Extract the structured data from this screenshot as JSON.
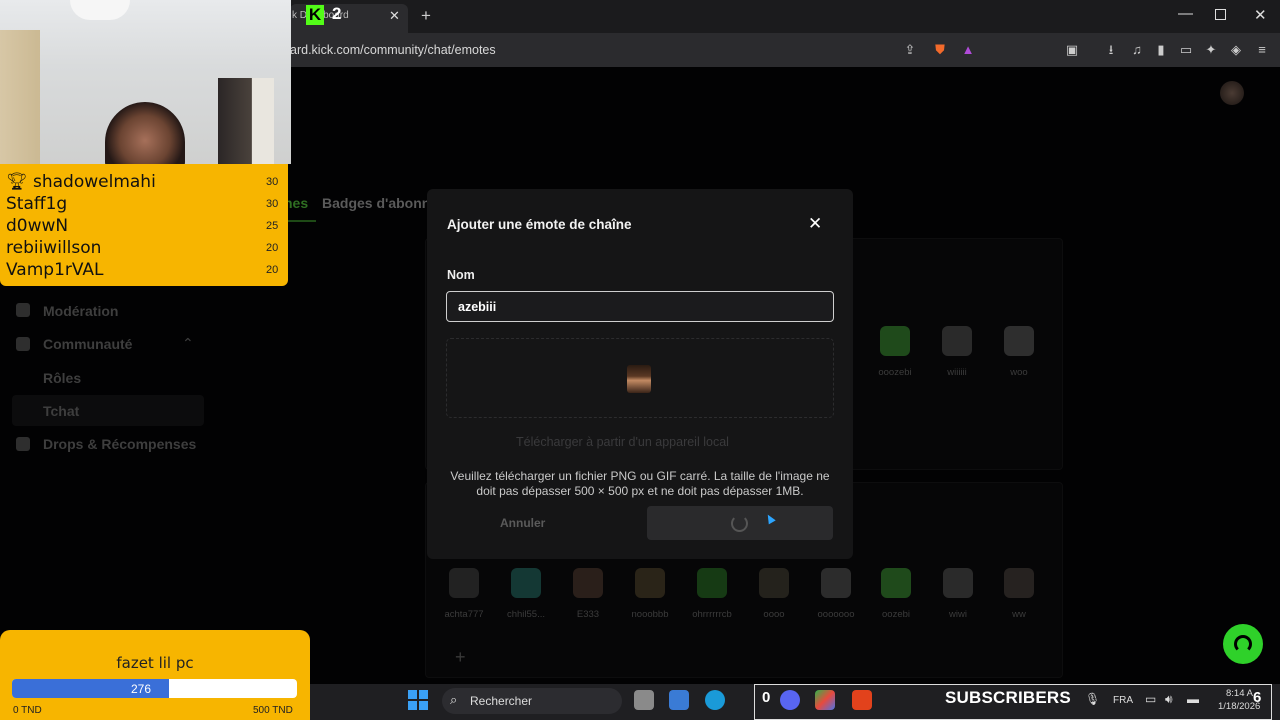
{
  "browser": {
    "tab_title": "k Dashboard",
    "url": "ard.kick.com/community/chat/emotes",
    "kick_badge": "K",
    "kick_number": "2"
  },
  "page": {
    "tabs": [
      {
        "label": "nes"
      },
      {
        "label": "Badges d'abonn"
      }
    ],
    "sidebar": {
      "items": [
        {
          "label": "Modération"
        },
        {
          "label": "Communauté"
        },
        {
          "label": "Rôles"
        },
        {
          "label": "Tchat"
        },
        {
          "label": "Drops & Récompenses"
        }
      ]
    },
    "emotes_row1": [
      "ooozebi",
      "wiiiiii",
      "woo"
    ],
    "emotes_row2": [
      "achta777",
      "chhil55...",
      "E333",
      "nooobbb",
      "ohrrrrrrcb",
      "oooo",
      "ooooooo",
      "oozebi",
      "wiwi",
      "ww"
    ]
  },
  "modal": {
    "title": "Ajouter une émote de chaîne",
    "name_label": "Nom",
    "name_value": "azebiii",
    "upload_link": "Télécharger à partir d'un appareil local",
    "hint": "Veuillez télécharger un fichier PNG ou GIF carré. La taille de l'image ne doit pas dépasser 500 × 500 px et ne doit pas dépasser 1MB.",
    "cancel_label": "Annuler"
  },
  "overlay": {
    "leaderboard": [
      {
        "name": "shadowelmahi",
        "value": "30"
      },
      {
        "name": "Staff1g",
        "value": "30"
      },
      {
        "name": "d0wwN",
        "value": "25"
      },
      {
        "name": "rebiiwillson",
        "value": "20"
      },
      {
        "name": "Vamp1rVAL",
        "value": "20"
      }
    ],
    "goal": {
      "title": "fazet lil pc",
      "current": "276",
      "progress_fraction": 0.552,
      "min_label": "0 TND",
      "max_label": "500 TND"
    }
  },
  "taskbar": {
    "search_label": "Rechercher",
    "subs_label": "SUBSCRIBERS",
    "subs_left": "0",
    "subs_right": "6",
    "lang": "FRA",
    "time": "8:14 A",
    "date": "1/18/2026"
  }
}
